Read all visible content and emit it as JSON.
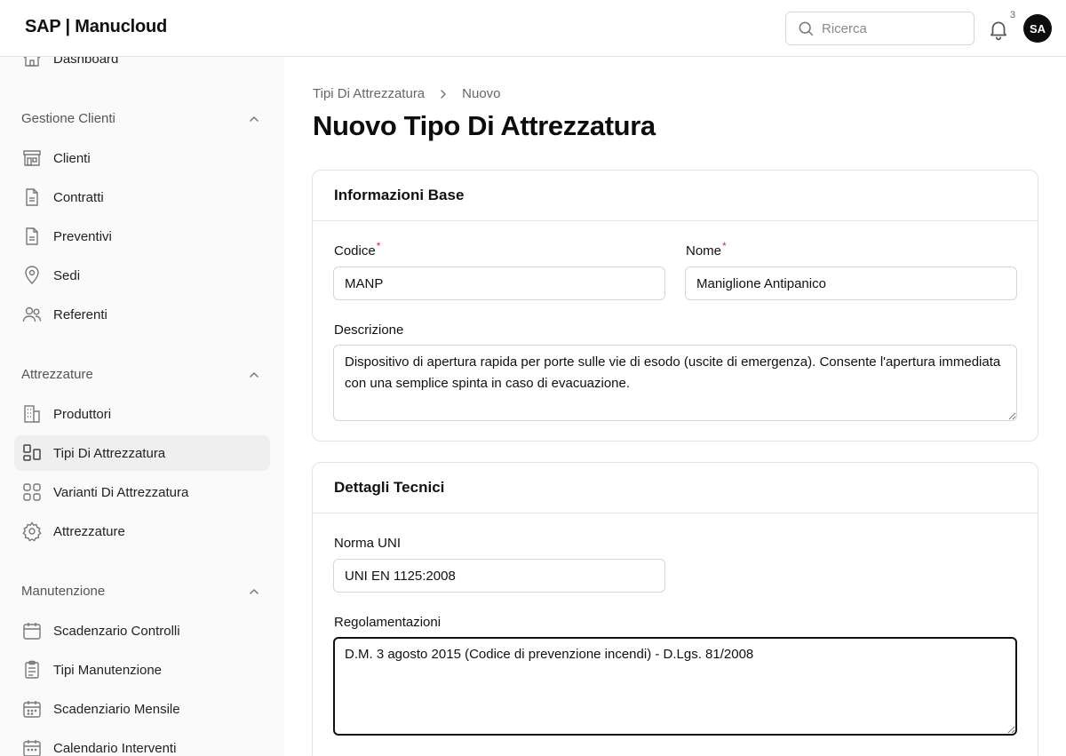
{
  "app": {
    "brand": "SAP | Manucloud"
  },
  "header": {
    "search_placeholder": "Ricerca",
    "notifications_count": "3",
    "avatar_initials": "SA"
  },
  "sidebar": {
    "top_item": "Dashboard",
    "sections": [
      {
        "title": "Gestione Clienti",
        "items": [
          "Clienti",
          "Contratti",
          "Preventivi",
          "Sedi",
          "Referenti"
        ]
      },
      {
        "title": "Attrezzature",
        "items": [
          "Produttori",
          "Tipi Di Attrezzatura",
          "Varianti Di Attrezzatura",
          "Attrezzature"
        ]
      },
      {
        "title": "Manutenzione",
        "items": [
          "Scadenzario Controlli",
          "Tipi Manutenzione",
          "Scadenziario Mensile",
          "Calendario Interventi"
        ]
      }
    ],
    "active_item": "Tipi Di Attrezzatura"
  },
  "breadcrumb": [
    "Tipi Di Attrezzatura",
    "Nuovo"
  ],
  "page_title": "Nuovo Tipo Di Attrezzatura",
  "base_info": {
    "title": "Informazioni Base",
    "codice_label": "Codice",
    "codice_value": "MANP",
    "nome_label": "Nome",
    "nome_value": "Maniglione Antipanico",
    "required_mark": "*",
    "descrizione_label": "Descrizione",
    "descrizione_value": "Dispositivo di apertura rapida per porte sulle vie di esodo (uscite di emergenza). Consente l'apertura immediata con una semplice spinta in caso di evacuazione."
  },
  "tech_details": {
    "title": "Dettagli Tecnici",
    "norma_label": "Norma UNI",
    "norma_value": "UNI EN 1125:2008",
    "regolamentazioni_label": "Regolamentazioni",
    "regolamentazioni_value": "D.M. 3 agosto 2015 (Codice di prevenzione incendi) - D.Lgs. 81/2008"
  },
  "colors": {
    "accent": "#111111",
    "required": "#e0282e",
    "sidebar_bg": "#fafafa",
    "active_bg": "#efefef"
  }
}
